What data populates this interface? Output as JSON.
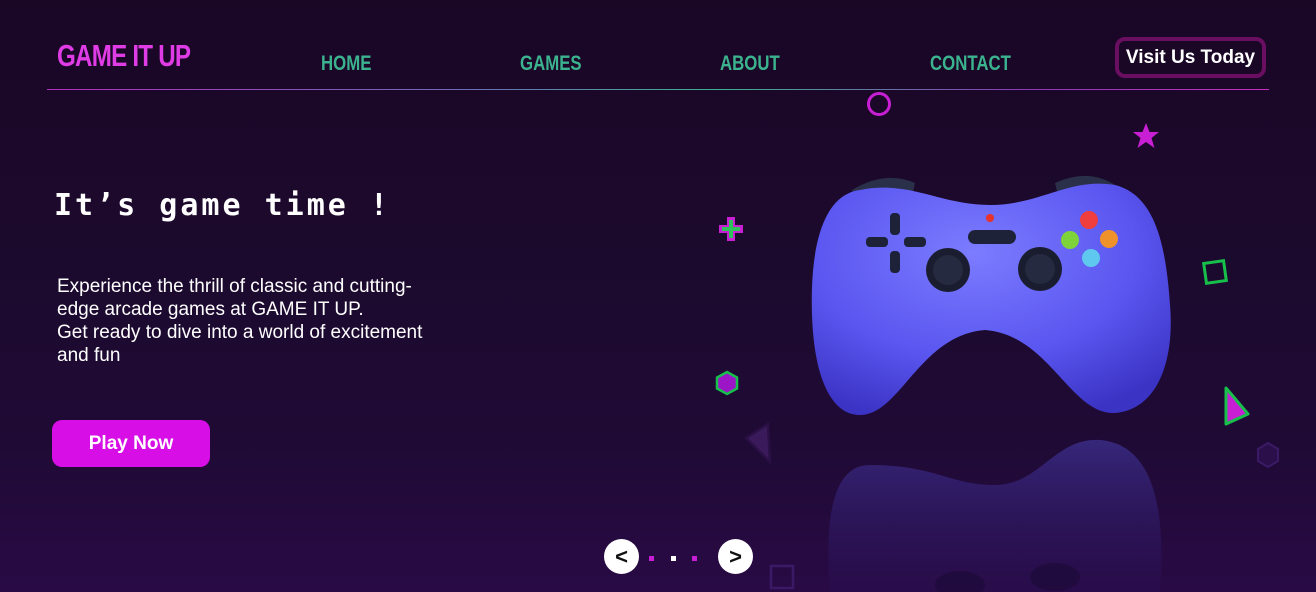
{
  "brand": {
    "logo_text": "GAME IT UP"
  },
  "nav": {
    "items": [
      {
        "label": "HOME"
      },
      {
        "label": "GAMES"
      },
      {
        "label": "ABOUT"
      },
      {
        "label": "CONTACT"
      }
    ],
    "cta_label": "Visit Us Today"
  },
  "hero": {
    "title": "It’s game time !",
    "description_lines": [
      "Experience the thrill of classic and cutting-edge arcade games at GAME IT UP.",
      "Get ready to dive into a world of excitement and fun"
    ],
    "play_label": "Play Now"
  },
  "carousel": {
    "prev_label": "<",
    "next_label": ">",
    "slide_count": 3,
    "active_index": 0
  },
  "icons": {
    "hero_image": "gamepad-controller-icon",
    "decorations": [
      "circle-icon",
      "star-icon",
      "plus-icon",
      "square-outline-icon",
      "hexagon-icon",
      "triangle-icon"
    ]
  },
  "colors": {
    "background": "#1c0a2e",
    "brand_magenta": "#e03ce6",
    "nav_green": "#3bb38e",
    "play_button": "#d70ee6",
    "cta_border": "#6a0e61",
    "controller_blue": "#5a5af0"
  }
}
